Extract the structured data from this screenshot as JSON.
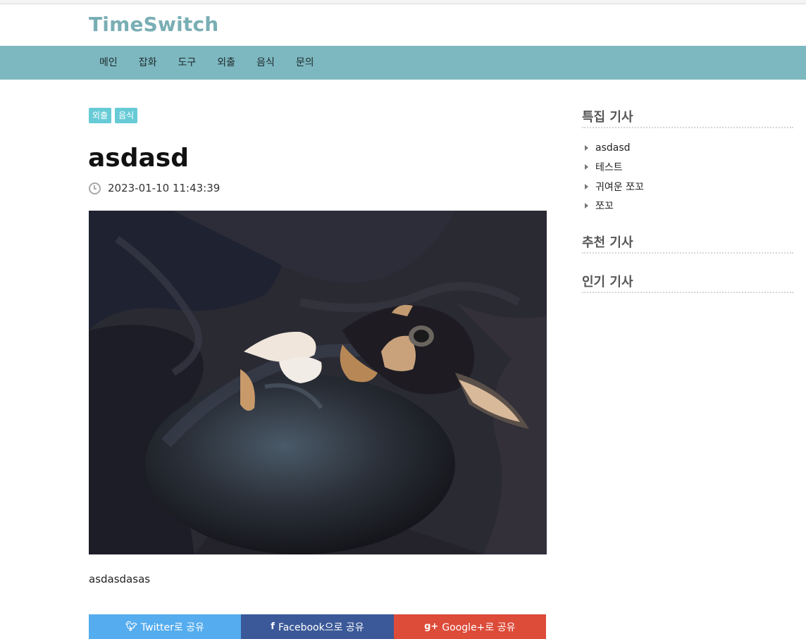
{
  "site": {
    "logo": "TimeSwitch"
  },
  "nav": {
    "items": [
      "메인",
      "잡화",
      "도구",
      "외출",
      "음식",
      "문의"
    ]
  },
  "post": {
    "tags": [
      "외출",
      "음식"
    ],
    "title": "asdasd",
    "date": "2023-01-10 11:43:39",
    "body": "asdasdasas",
    "image": {
      "subject": "chihuahua curled up on dark blanket"
    }
  },
  "share": {
    "twitter": {
      "label": "Twitter로 공유",
      "icon": "twitter-icon"
    },
    "facebook": {
      "label": "Facebook으로 공유",
      "icon": "facebook-icon"
    },
    "google": {
      "label": "Google+로 공유",
      "icon": "google-plus-icon"
    }
  },
  "sidebar": {
    "featured": {
      "title": "특집 기사",
      "items": [
        "asdasd",
        "테스트",
        "귀여운 쪼꼬",
        "쪼꼬"
      ]
    },
    "recommended": {
      "title": "추천 기사"
    },
    "popular": {
      "title": "인기 기사"
    }
  },
  "colors": {
    "nav_bg": "#7db8c0",
    "logo": "#79aeb4",
    "tag_bg": "#67cbd6",
    "twitter": "#55acee",
    "facebook": "#3b5998",
    "google": "#dd4b39"
  }
}
